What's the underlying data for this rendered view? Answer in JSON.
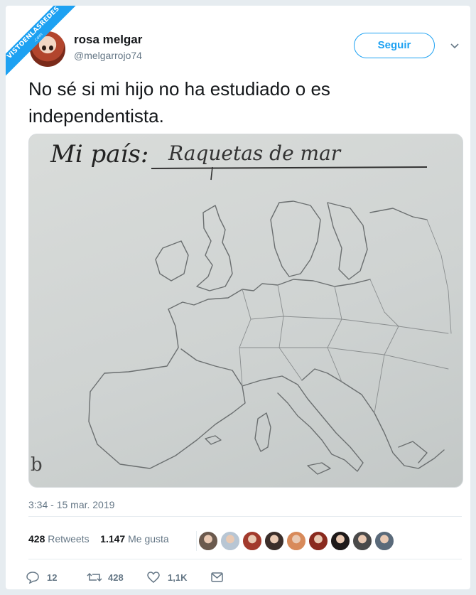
{
  "watermark": {
    "line1": "VISTOENLASREDES",
    "line2": ".com"
  },
  "author": {
    "name": "rosa melgar",
    "handle": "@melgarrojo74"
  },
  "follow_label": "Seguir",
  "tweet": {
    "text": "No sé si mi hijo no ha estudiado o es independentista.",
    "photo": {
      "heading": "Mi país:",
      "answer": "Raquetas de mar",
      "corner_mark": "b"
    }
  },
  "timestamp": "3:34 - 15 mar. 2019",
  "stats": {
    "retweets_count": "428",
    "retweets_label": "Retweets",
    "likes_count": "1.147",
    "likes_label": "Me gusta"
  },
  "likers_count": 9,
  "actions": {
    "replies": "12",
    "retweets": "428",
    "likes": "1,1K"
  },
  "colors": {
    "accent": "#1da1f2",
    "muted": "#657786",
    "text": "#14171a",
    "background": "#e6ecf0"
  },
  "icons": [
    "chevron-down-icon",
    "reply-icon",
    "retweet-icon",
    "like-icon",
    "direct-message-icon"
  ]
}
